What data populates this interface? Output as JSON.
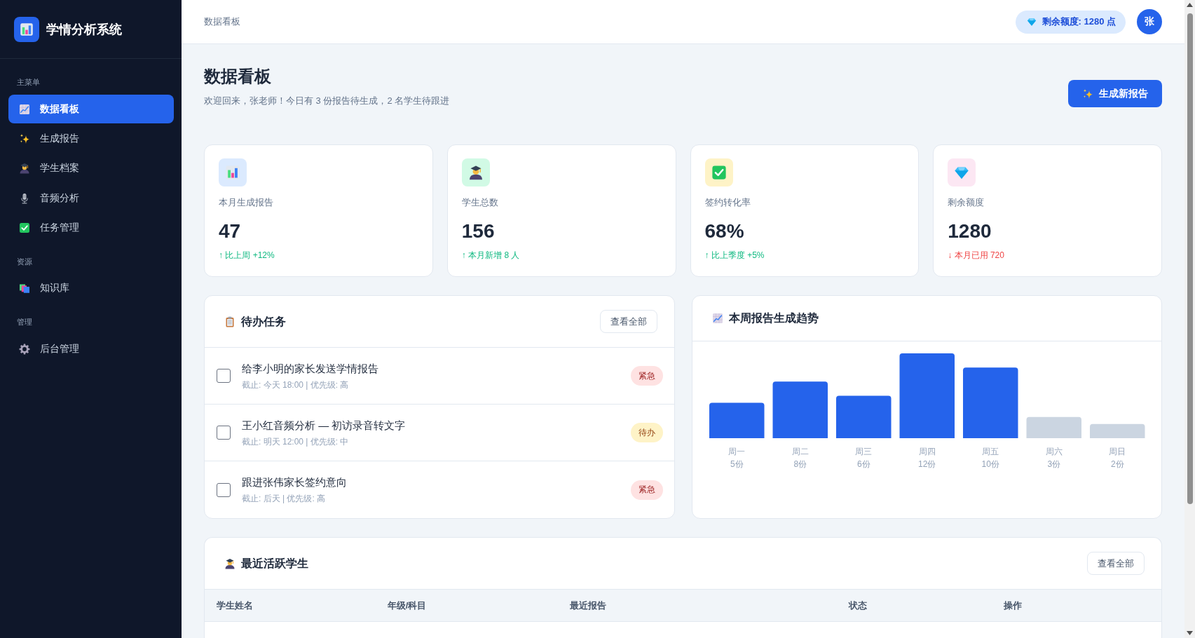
{
  "sidebar": {
    "logo_title": "学情分析系统",
    "sections": [
      {
        "label": "主菜单",
        "items": [
          {
            "label": "数据看板",
            "selected": true
          },
          {
            "label": "生成报告",
            "selected": false
          },
          {
            "label": "学生档案",
            "selected": false
          },
          {
            "label": "音频分析",
            "selected": false
          },
          {
            "label": "任务管理",
            "selected": false
          }
        ]
      },
      {
        "label": "资源",
        "items": [
          {
            "label": "知识库",
            "selected": false
          }
        ]
      },
      {
        "label": "管理",
        "items": [
          {
            "label": "后台管理",
            "selected": false
          }
        ]
      }
    ]
  },
  "header": {
    "breadcrumb": "数据看板",
    "quota": "剩余额度: 1280 点",
    "avatar": "张"
  },
  "page": {
    "title": "数据看板",
    "subtitle": "欢迎回来，张老师！今日有 3 份报告待生成，2 名学生待跟进",
    "primary_button": "生成新报告"
  },
  "stats": [
    {
      "label": "本月生成报告",
      "value": "47",
      "delta": "↑ 比上周 +12%",
      "down": false,
      "color": "#dbeafe"
    },
    {
      "label": "学生总数",
      "value": "156",
      "delta": "↑ 本月新增 8 人",
      "down": false,
      "color": "#d1fae5"
    },
    {
      "label": "签约转化率",
      "value": "68%",
      "delta": "↑ 比上季度 +5%",
      "down": false,
      "color": "#fef3c7"
    },
    {
      "label": "剩余额度",
      "value": "1280",
      "delta": "↓ 本月已用 720",
      "down": true,
      "color": "#fce7f3"
    }
  ],
  "tasks": {
    "title": "待办任务",
    "view_all": "查看全部",
    "items": [
      {
        "title": "给李小明的家长发送学情报告",
        "meta": "截止: 今天 18:00 | 优先级: 高",
        "checked": false,
        "badge": {
          "label": "紧急",
          "kind": "urgent"
        }
      },
      {
        "title": "王小红音频分析 — 初访录音转文字",
        "meta": "截止: 明天 12:00 | 优先级: 中",
        "checked": false,
        "badge": {
          "label": "待办",
          "kind": "todo"
        }
      },
      {
        "title": "跟进张伟家长签约意向",
        "meta": "截止: 后天 | 优先级: 高",
        "checked": false,
        "badge": {
          "label": "紧急",
          "kind": "urgent"
        }
      }
    ]
  },
  "trend": {
    "title": "本周报告生成趋势",
    "chart_data": {
      "type": "bar",
      "categories": [
        "周一",
        "周二",
        "周三",
        "周四",
        "周五",
        "周六",
        "周日"
      ],
      "values": [
        5,
        8,
        6,
        12,
        10,
        3,
        2
      ],
      "value_labels": [
        "5份",
        "8份",
        "6份",
        "12份",
        "10份",
        "3份",
        "2份"
      ],
      "colors": [
        "#2563eb",
        "#2563eb",
        "#2563eb",
        "#2563eb",
        "#2563eb",
        "#cbd5e1",
        "#cbd5e1"
      ],
      "ylim": [
        0,
        12
      ]
    }
  },
  "students": {
    "title": "最近活跃学生",
    "view_all": "查看全部",
    "table": {
      "columns": [
        "学生姓名",
        "年级/科目",
        "最近报告",
        "状态",
        "操作"
      ]
    }
  }
}
